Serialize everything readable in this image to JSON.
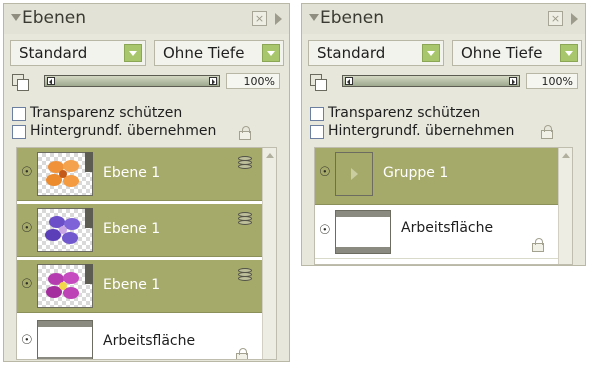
{
  "colors": {
    "panel_bg": "#e8e7dc",
    "selected_layer": "#a5aa6a",
    "dropdown_accent": "#a8c66c"
  },
  "panels": [
    {
      "title": "Ebenen",
      "blend_mode": "Standard",
      "depth_mode": "Ohne Tiefe",
      "opacity": "100%",
      "opacity_value": 100,
      "checkbox_protect": "Transparenz schützen",
      "checkbox_background": "Hintergrundf. übernehmen",
      "layers": [
        {
          "name": "Ebene 1",
          "flower": "orange",
          "selected": true
        },
        {
          "name": "Ebene 1",
          "flower": "purple",
          "selected": true
        },
        {
          "name": "Ebene 1",
          "flower": "magenta",
          "selected": true
        },
        {
          "name": "Arbeitsfläche",
          "selected": false
        }
      ]
    },
    {
      "title": "Ebenen",
      "blend_mode": "Standard",
      "depth_mode": "Ohne Tiefe",
      "opacity": "100%",
      "opacity_value": 100,
      "checkbox_protect": "Transparenz schützen",
      "checkbox_background": "Hintergrundf. übernehmen",
      "layers": [
        {
          "name": "Gruppe 1",
          "selected": true
        },
        {
          "name": "Arbeitsfläche",
          "selected": false
        }
      ]
    }
  ]
}
